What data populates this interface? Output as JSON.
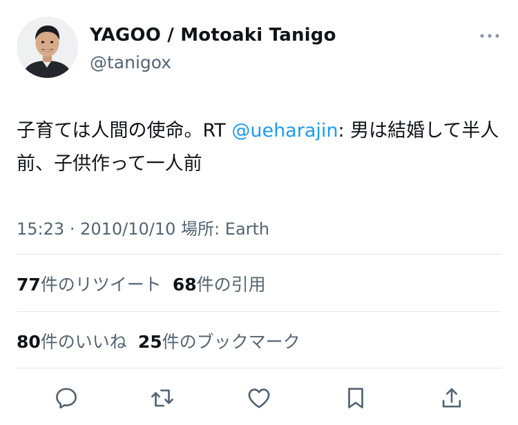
{
  "author": {
    "display_name": "YAGOO / Motoaki Tanigo",
    "handle": "@tanigox"
  },
  "tweet": {
    "text_before": "子育ては人間の使命。RT ",
    "mention": "@ueharajin",
    "text_after": ": 男は結婚して半人前、子供作って一人前"
  },
  "meta": {
    "time": "15:23",
    "separator": "·",
    "date": "2010/10/10",
    "location": "場所: Earth"
  },
  "stats": {
    "retweets_count": "77",
    "retweets_label": "件のリツイート",
    "quotes_count": "68",
    "quotes_label": "件の引用",
    "likes_count": "80",
    "likes_label": "件のいいね",
    "bookmarks_count": "25",
    "bookmarks_label": "件のブックマーク"
  },
  "actions": [
    "reply-icon",
    "retweet-icon",
    "like-icon",
    "bookmark-icon",
    "share-icon"
  ],
  "colors": {
    "text": "#0f1419",
    "secondary": "#536471",
    "link": "#1d9bf0",
    "divider": "#e3e7ea"
  }
}
